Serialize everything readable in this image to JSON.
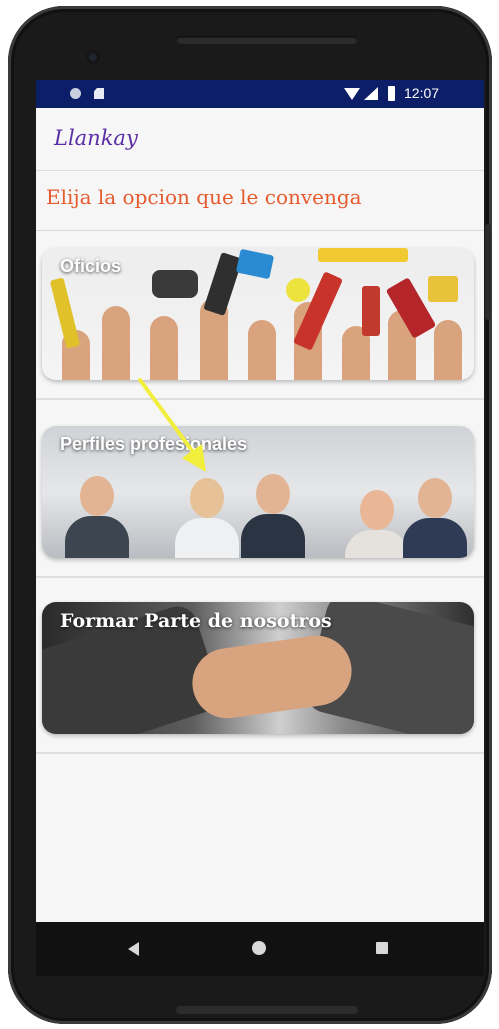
{
  "status_bar": {
    "time": "12:07"
  },
  "app_bar": {
    "title": "Llankay"
  },
  "header": {
    "text": "Elija la opcion que le convenga"
  },
  "cards": [
    {
      "label": "Oficios",
      "image": "tools-hands-image"
    },
    {
      "label": "Perfiles profesionales",
      "image": "professionals-image"
    },
    {
      "label": "Formar Parte de nosotros",
      "image": "handshake-image"
    }
  ],
  "annotation": {
    "arrow_color": "#f2ee3c"
  },
  "colors": {
    "status_bar": "#0c1e68",
    "app_title": "#5b2fa5",
    "header_text": "#e65a2e",
    "screen_bg": "#f6f6f6"
  },
  "nav_bar": {
    "icons": [
      "back-icon",
      "home-icon",
      "recents-icon"
    ]
  }
}
